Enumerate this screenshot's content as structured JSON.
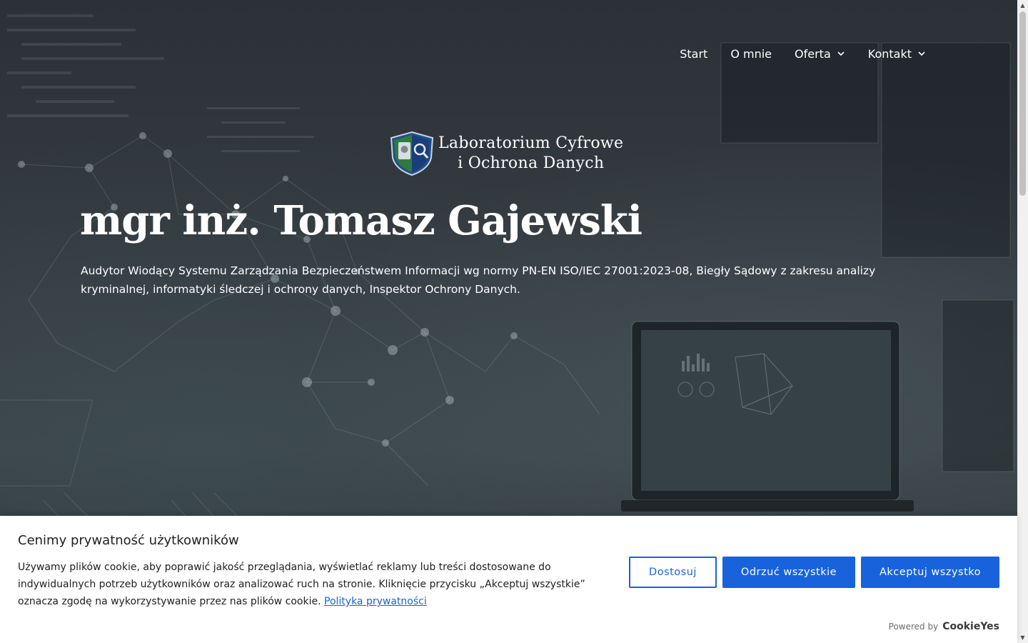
{
  "nav": {
    "items": [
      {
        "label": "Start",
        "has_dropdown": false
      },
      {
        "label": "O mnie",
        "has_dropdown": false
      },
      {
        "label": "Oferta",
        "has_dropdown": true
      },
      {
        "label": "Kontakt",
        "has_dropdown": true
      }
    ]
  },
  "logo": {
    "line1": "Laboratorium Cyfrowe",
    "line2": "i Ochrona Danych",
    "icon": "shield-magnifier-icon"
  },
  "hero": {
    "title": "mgr inż. Tomasz Gajewski",
    "subtitle": "Audytor Wiodący Systemu Zarządzania Bezpieczeństwem Informacji wg normy PN-EN ISO/IEC 27001:2023-08, Biegły Sądowy z zakresu analizy kryminalnej, informatyki śledczej i ochrony danych, Inspektor Ochrony Danych."
  },
  "cookie": {
    "title": "Cenimy prywatność użytkowników",
    "text": "Używamy plików cookie, aby poprawić jakość przeglądania, wyświetlać reklamy lub treści dostosowane do indywidualnych potrzeb użytkowników oraz analizować ruch na stronie. Kliknięcie przycisku „Akceptuj wszystkie” oznacza zgodę na wykorzystywanie przez nas plików cookie.",
    "policy_link": "Polityka prywatności",
    "customize_label": "Dostosuj",
    "reject_label": "Odrzuć wszystkie",
    "accept_label": "Akceptuj wszystko",
    "powered_by": "Powered by",
    "brand": "CookieYes"
  },
  "colors": {
    "accent": "#1863dc",
    "banner_bg": "#ffffff",
    "hero_text": "#ffffff"
  }
}
